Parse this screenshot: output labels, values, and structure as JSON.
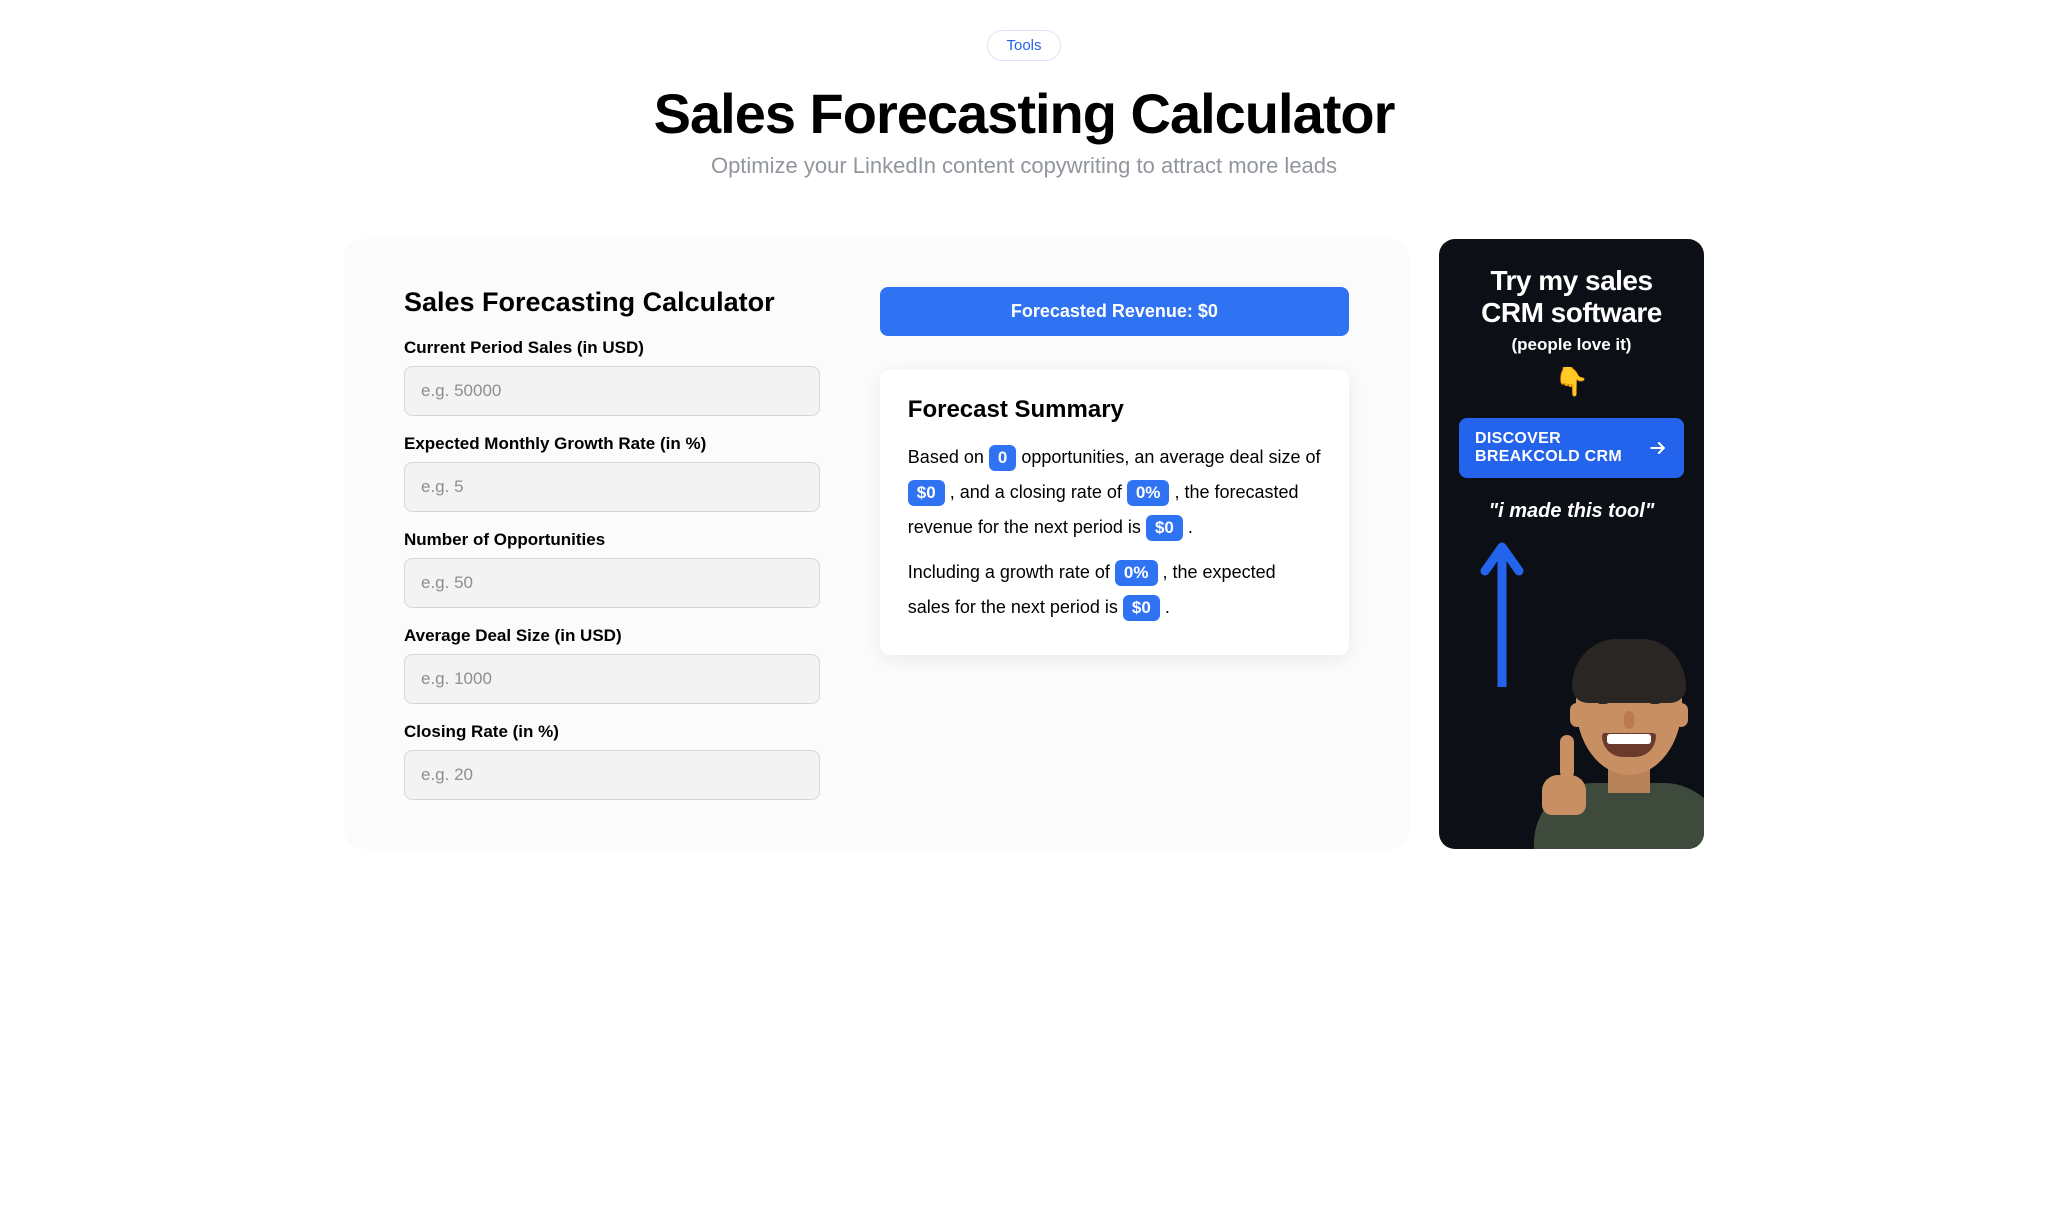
{
  "hero": {
    "badge": "Tools",
    "title": "Sales Forecasting Calculator",
    "subtitle": "Optimize your LinkedIn content copywriting to attract more leads"
  },
  "form": {
    "heading": "Sales Forecasting Calculator",
    "fields": {
      "current_sales": {
        "label": "Current Period Sales (in USD)",
        "placeholder": "e.g. 50000"
      },
      "growth_rate": {
        "label": "Expected Monthly Growth Rate (in %)",
        "placeholder": "e.g. 5"
      },
      "opportunities": {
        "label": "Number of Opportunities",
        "placeholder": "e.g. 50"
      },
      "deal_size": {
        "label": "Average Deal Size (in USD)",
        "placeholder": "e.g. 1000"
      },
      "closing_rate": {
        "label": "Closing Rate (in %)",
        "placeholder": "e.g. 20"
      }
    }
  },
  "forecast": {
    "banner_prefix": "Forecasted Revenue: ",
    "banner_value": "$0",
    "summary_title": "Forecast Summary",
    "s": {
      "t1": "Based on ",
      "opportunities": "0",
      "t2": " opportunities, an average deal size of ",
      "deal_size": "$0",
      "t3": " , and a closing rate of ",
      "closing_rate": "0%",
      "t4": " , the forecasted revenue for the next period is ",
      "revenue": "$0",
      "t5": " .",
      "t6": "Including a growth rate of ",
      "growth_rate": "0%",
      "t7": " , the expected sales for the next period is ",
      "expected_sales": "$0",
      "t8": " ."
    }
  },
  "sidebar": {
    "title_line1": "Try my sales",
    "title_line2": "CRM software",
    "love": "(people love it)",
    "cta_line1": "DISCOVER",
    "cta_line2": "BREAKCOLD CRM",
    "quote": "\"i made this tool\""
  }
}
